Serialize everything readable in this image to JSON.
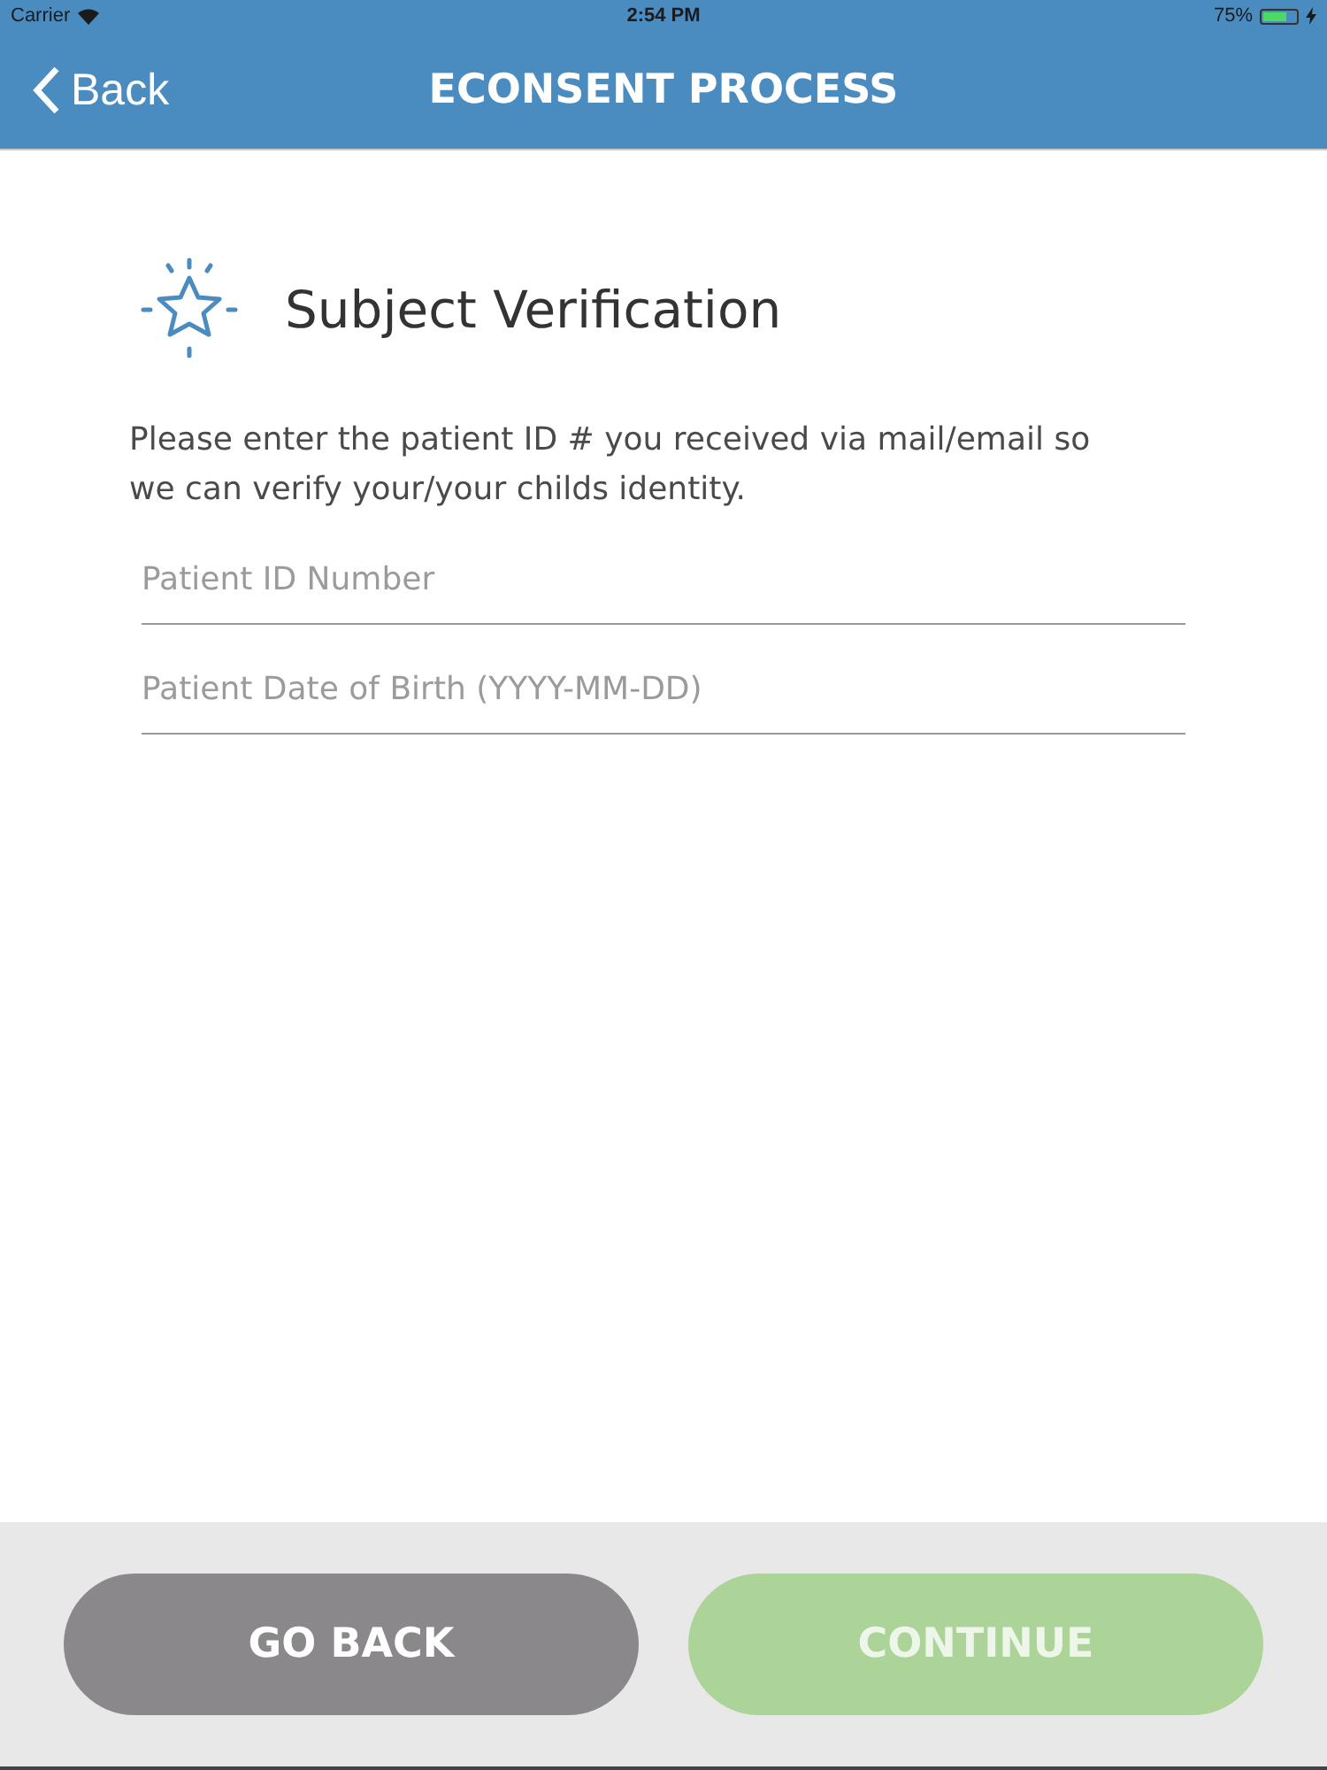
{
  "status_bar": {
    "carrier": "Carrier",
    "time": "2:54 PM",
    "battery": "75%"
  },
  "nav": {
    "back": "Back",
    "title": "ECONSENT PROCESS"
  },
  "heading": "Subject Verification",
  "instructions": "Please enter the patient ID # you received via mail/email so we can verify your/your childs identity.",
  "fields": [
    {
      "placeholder": "Patient ID Number"
    },
    {
      "placeholder": "Patient Date of Birth (YYYY-MM-DD)"
    }
  ],
  "buttons": [
    {
      "label": "GO BACK",
      "disabled": false
    },
    {
      "label": "CONTINUE",
      "disabled": true
    }
  ]
}
